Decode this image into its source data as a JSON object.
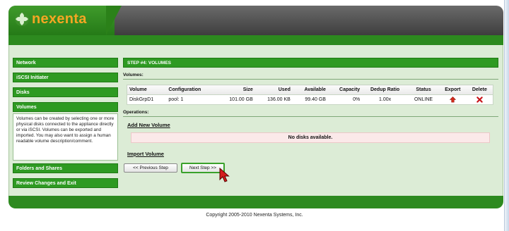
{
  "brand": {
    "name": "nexenta",
    "text_color": "#f5a623",
    "accent_green": "#2e9a22"
  },
  "sidebar": {
    "network": "Network",
    "iscsi": "iSCSI Initiater",
    "disks": "Disks",
    "volumes": "Volumes",
    "volumes_description": "Volumes can be created by selecting one or more physical disks connected to the appliance directly or via iSCSI. Volumes can be exported and imported. You may also want to assign a human readable volume description/comment.",
    "folders": "Folders and Shares",
    "review": "Review Changes and Exit"
  },
  "content": {
    "title": "STEP #4: VOLUMES",
    "volumes_label": "Volumes:",
    "operations_label": "Operations:",
    "add_new_volume": "Add New Volume",
    "no_disks": "No disks available.",
    "import_volume": "Import Volume",
    "prev_button": "<< Previous Step",
    "next_button": "Next Step >>"
  },
  "table": {
    "headers": {
      "volume": "Volume",
      "configuration": "Configuration",
      "size": "Size",
      "used": "Used",
      "available": "Available",
      "capacity": "Capacity",
      "dedup": "Dedup Ratio",
      "status": "Status",
      "export": "Export",
      "delete": "Delete"
    },
    "rows": [
      {
        "volume": "DiskGrpD1",
        "configuration": "pool: 1",
        "size": "101.00 GB",
        "used": "136.00 KB",
        "available": "99.40 GB",
        "capacity": "0%",
        "dedup": "1.00x",
        "status": "ONLINE",
        "export_icon": "export-arrow-icon",
        "delete_icon": "delete-x-icon"
      }
    ]
  },
  "footer": {
    "copyright": "Copyright 2005-2010 Nexenta Systems, Inc."
  }
}
